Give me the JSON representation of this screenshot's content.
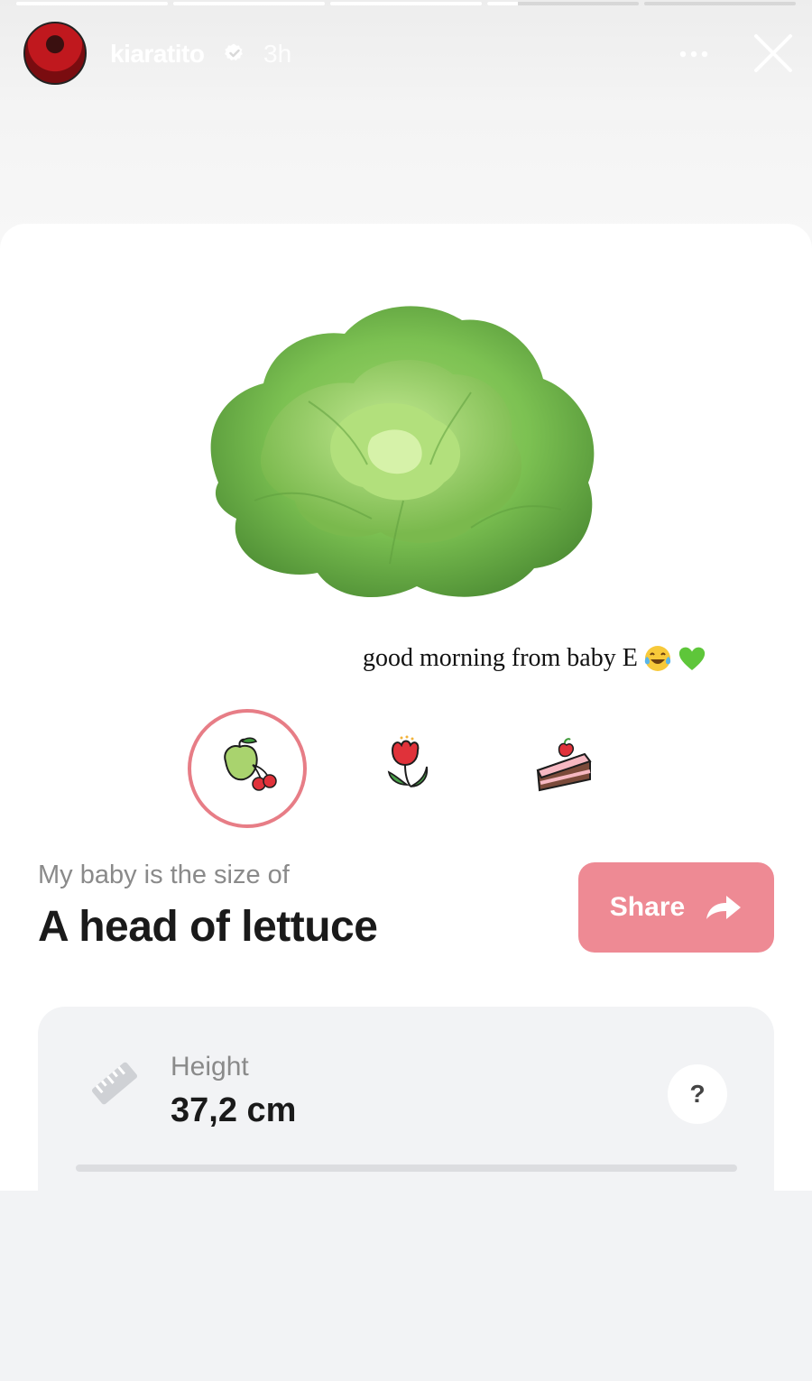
{
  "story": {
    "progress_segments": [
      1,
      1,
      1,
      0.2,
      0
    ]
  },
  "header": {
    "username": "kiaratito",
    "time_ago": "3h",
    "icons": {
      "verified": "verified-badge-icon",
      "more": "more-dots-icon",
      "close": "close-icon"
    }
  },
  "post": {
    "caption": "good morning from baby E",
    "caption_emojis": [
      "tears-of-joy-emoji",
      "green-heart-emoji"
    ]
  },
  "app": {
    "categories": [
      {
        "icon": "fruit-apple-cherry-icon",
        "selected": true
      },
      {
        "icon": "flower-tulip-icon",
        "selected": false
      },
      {
        "icon": "cake-slice-icon",
        "selected": false
      }
    ],
    "size_label": "My baby is the size of",
    "size_value": "A head of lettuce",
    "share_label": "Share",
    "stat": {
      "icon": "ruler-icon",
      "label": "Height",
      "value": "37,2 cm",
      "help_label": "?"
    }
  },
  "colors": {
    "accent_pink": "#ee8a94",
    "selection_ring": "#e77d86",
    "lettuce_green": "#7cc152"
  }
}
